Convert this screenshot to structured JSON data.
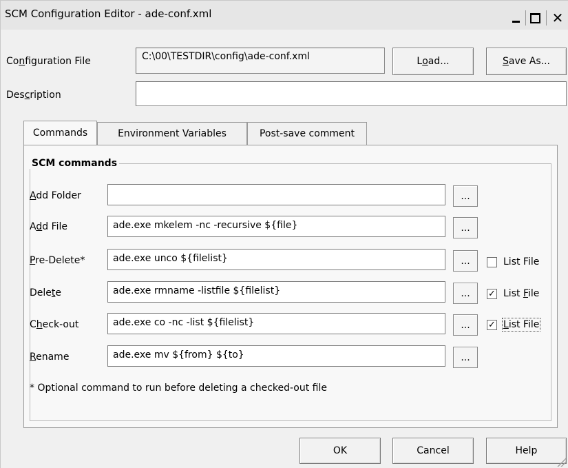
{
  "window": {
    "title": "SCM Configuration Editor - ade-conf.xml",
    "minimize_glyph": "_",
    "close_glyph": "✕"
  },
  "config_file": {
    "label_pre": "Co",
    "label_ul": "n",
    "label_post": "figuration File",
    "value": "C:\\00\\TESTDIR\\config\\ade-conf.xml"
  },
  "description": {
    "label_pre": "Des",
    "label_ul": "c",
    "label_post": "ription",
    "value": ""
  },
  "buttons": {
    "load_pre": "L",
    "load_ul": "o",
    "load_post": "ad...",
    "save_as_ul": "S",
    "save_as_post": "ave As...",
    "ok": "OK",
    "cancel": "Cancel",
    "help": "Help"
  },
  "tabs": [
    {
      "label": "Commands",
      "active": true
    },
    {
      "label": "Environment Variables",
      "active": false
    },
    {
      "label": "Post-save comment",
      "active": false
    }
  ],
  "group": {
    "title": "SCM commands"
  },
  "commands": [
    {
      "label_ul": "A",
      "label_rest": "dd Folder",
      "value": "",
      "has_list_file": false
    },
    {
      "label_pre": "A",
      "label_ul": "d",
      "label_rest": "d File",
      "value": "ade.exe mkelem -nc -recursive ${file}",
      "has_list_file": false
    },
    {
      "label_ul": "P",
      "label_rest": "re-Delete*",
      "value": "ade.exe unco ${filelist}",
      "has_list_file": true,
      "list_checked": false,
      "list_label_ul": "",
      "list_label": "List File"
    },
    {
      "label_pre": "Dele",
      "label_ul": "t",
      "label_rest": "e",
      "value": "ade.exe rmname -listfile ${filelist}",
      "has_list_file": true,
      "list_checked": true,
      "list_label_pre": "List ",
      "list_label_ul": "F",
      "list_label_rest": "ile"
    },
    {
      "label_pre": "C",
      "label_ul": "h",
      "label_rest": "eck-out",
      "value": "ade.exe co -nc -list ${filelist}",
      "has_list_file": true,
      "list_checked": true,
      "list_label_ul": "L",
      "list_label_rest": "ist File"
    },
    {
      "label_ul": "R",
      "label_rest": "ename",
      "value": "ade.exe mv ${from} ${to}",
      "has_list_file": false
    }
  ],
  "browse_label": "...",
  "check_glyph": "✓",
  "footnote": "* Optional command to run before deleting a checked-out file"
}
